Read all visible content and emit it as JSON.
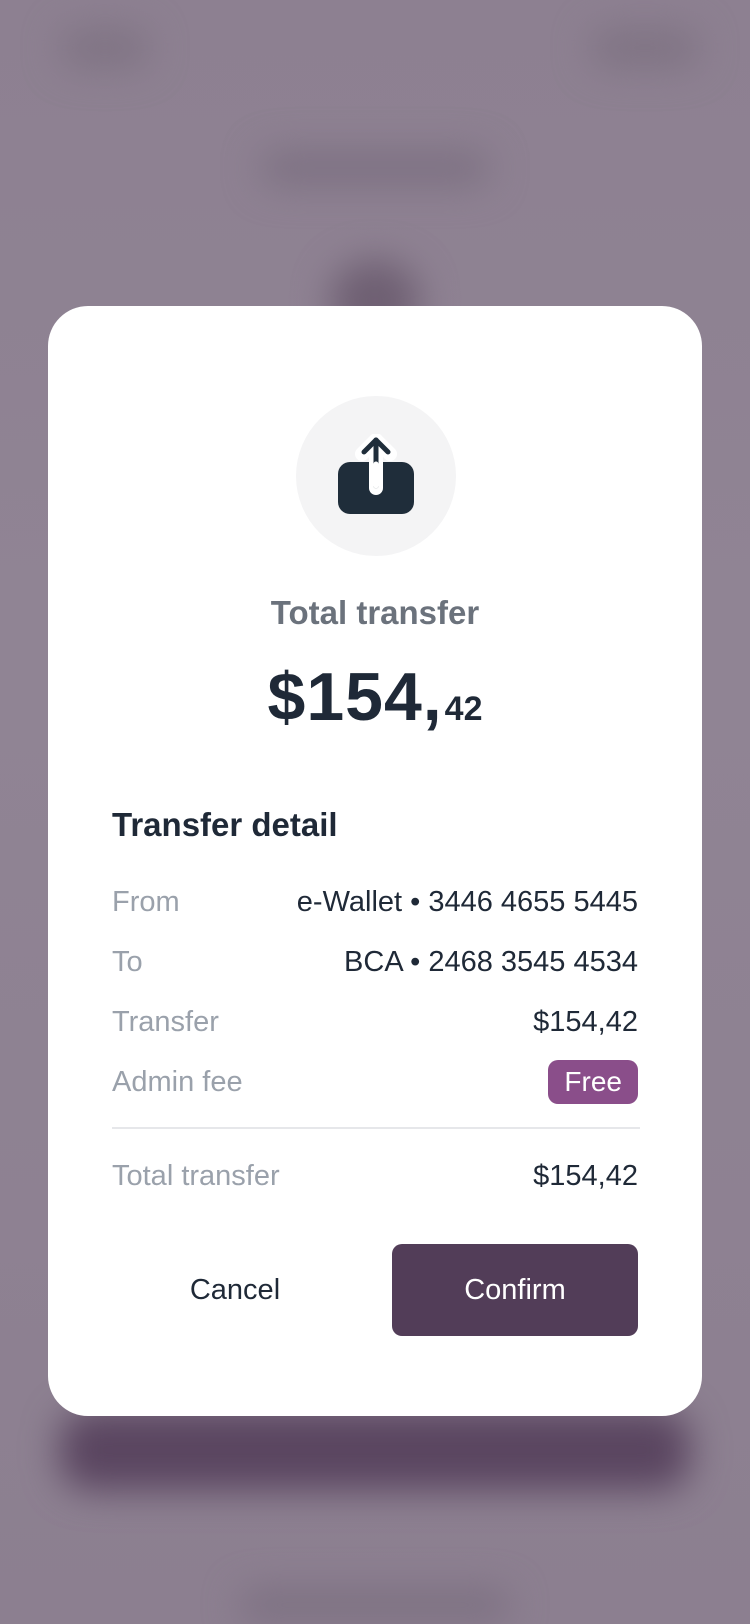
{
  "colors": {
    "accent": "#523d58",
    "badge": "#8a4e8a",
    "text_primary": "#1f2937",
    "text_muted": "#9aa1ab",
    "overlay": "#8e8192"
  },
  "modal": {
    "icon": "upload-share-icon",
    "headline": "Total transfer",
    "amount_major": "$154,",
    "amount_minor": "42",
    "section_title": "Transfer detail",
    "rows": [
      {
        "label": "From",
        "value": "e-Wallet • 3446 4655 5445"
      },
      {
        "label": "To",
        "value": "BCA • 2468 3545 4534"
      },
      {
        "label": "Transfer",
        "value": "$154,42"
      },
      {
        "label": "Admin fee",
        "value": "Free"
      }
    ],
    "total": {
      "label": "Total transfer",
      "value": "$154,42"
    },
    "cancel_label": "Cancel",
    "confirm_label": "Confirm"
  }
}
